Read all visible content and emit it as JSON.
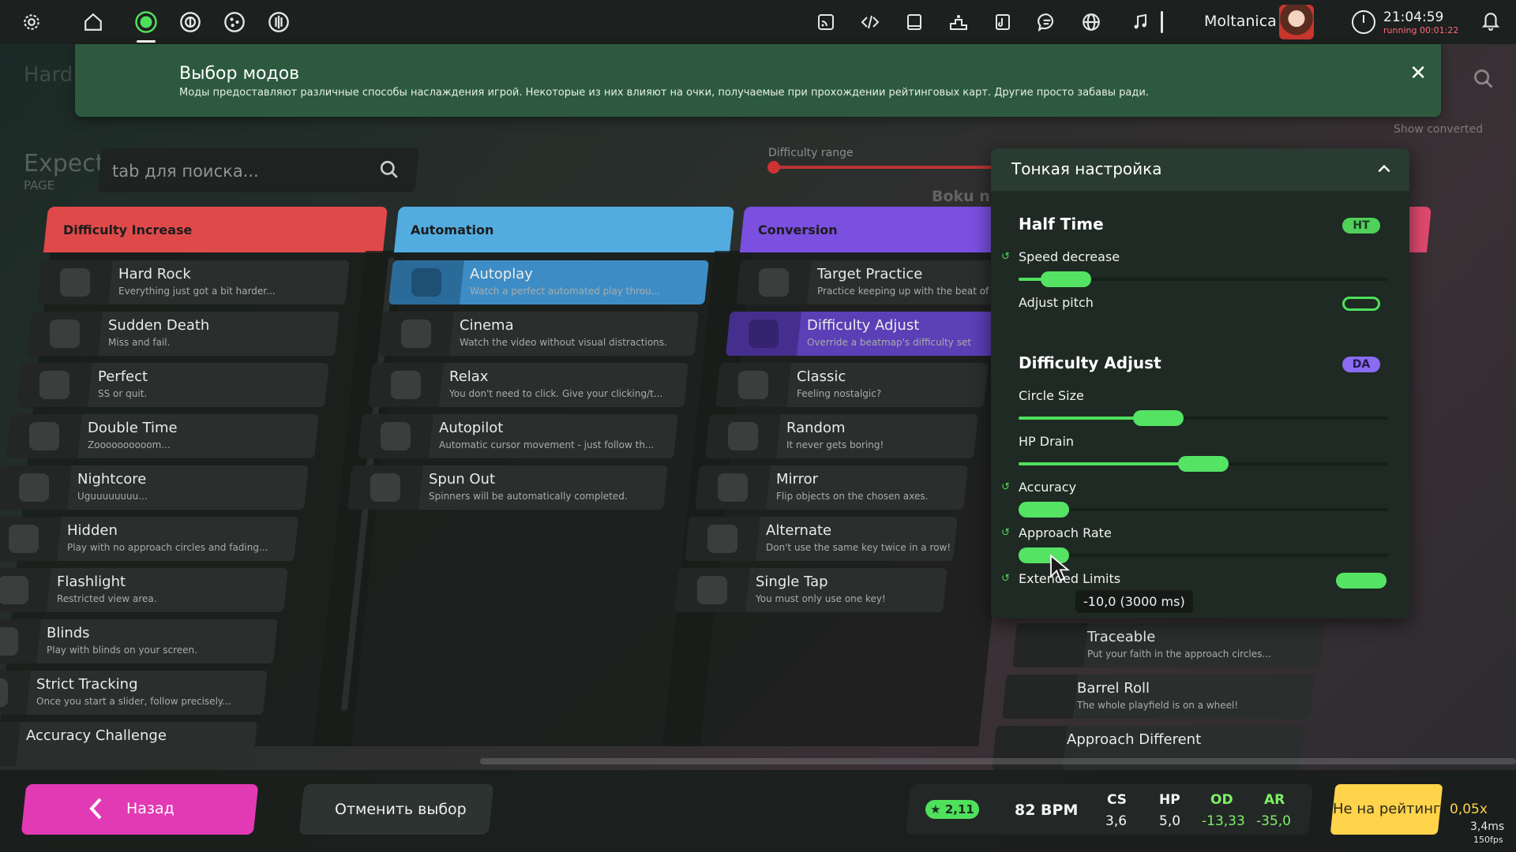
{
  "toolbar": {
    "username": "Moltanica",
    "time": "21:04:59",
    "running": "running 00:01:22"
  },
  "background": {
    "hard": "Hard",
    "expect": "Expect",
    "page": "PAGE",
    "difficulty_range": "Difficulty range",
    "show_converted": "Show converted",
    "boku": "Boku n"
  },
  "banner": {
    "title": "Выбор модов",
    "description": "Моды предоставляют различные способы наслаждения игрой. Некоторые из них влияют на очки, получаемые при прохождении рейтинговых карт. Другие просто забавы ради."
  },
  "search": {
    "placeholder": "tab для поиска..."
  },
  "columns": [
    {
      "title": "Difficulty Increase",
      "color": "#e0494a",
      "mods": [
        {
          "name": "Hard Rock",
          "desc": "Everything just got a bit harder..."
        },
        {
          "name": "Sudden Death",
          "desc": "Miss and fail."
        },
        {
          "name": "Perfect",
          "desc": "SS or quit."
        },
        {
          "name": "Double Time",
          "desc": "Zoooooooooom..."
        },
        {
          "name": "Nightcore",
          "desc": "Uguuuuuuuu..."
        },
        {
          "name": "Hidden",
          "desc": "Play with no approach circles and fading..."
        },
        {
          "name": "Flashlight",
          "desc": "Restricted view area."
        },
        {
          "name": "Blinds",
          "desc": "Play with blinds on your screen."
        },
        {
          "name": "Strict Tracking",
          "desc": "Once you start a slider, follow precisely..."
        },
        {
          "name": "Accuracy Challenge",
          "desc": ""
        }
      ]
    },
    {
      "title": "Automation",
      "color": "#52acdf",
      "mods": [
        {
          "name": "Autoplay",
          "desc": "Watch a perfect automated play throu...",
          "selected": true
        },
        {
          "name": "Cinema",
          "desc": "Watch the video without visual distractions."
        },
        {
          "name": "Relax",
          "desc": "You don't need to click. Give your clicking/t..."
        },
        {
          "name": "Autopilot",
          "desc": "Automatic cursor movement - just follow th..."
        },
        {
          "name": "Spun Out",
          "desc": "Spinners will be automatically completed."
        }
      ]
    },
    {
      "title": "Conversion",
      "color": "#7b4fe0",
      "mods": [
        {
          "name": "Target Practice",
          "desc": "Practice keeping up with the beat of"
        },
        {
          "name": "Difficulty Adjust",
          "desc": "Override a beatmap's difficulty set",
          "selected": true
        },
        {
          "name": "Classic",
          "desc": "Feeling nostalgic?"
        },
        {
          "name": "Random",
          "desc": "It never gets boring!"
        },
        {
          "name": "Mirror",
          "desc": "Flip objects on the chosen axes."
        },
        {
          "name": "Alternate",
          "desc": "Don't use the same key twice in a row!"
        },
        {
          "name": "Single Tap",
          "desc": "You must only use one key!"
        }
      ]
    }
  ],
  "fun_mods": [
    {
      "name": "Traceable",
      "desc": "Put your faith in the approach circles..."
    },
    {
      "name": "Barrel Roll",
      "desc": "The whole playfield is on a wheel!"
    },
    {
      "name": "Approach Different",
      "desc": ""
    }
  ],
  "panel": {
    "title": "Тонкая настройка",
    "half_time": {
      "title": "Half Time",
      "badge": "HT",
      "speed_decrease": "Speed decrease",
      "speed_value": 0.07,
      "adjust_pitch": "Adjust pitch",
      "adjust_pitch_on": false
    },
    "difficulty_adjust": {
      "title": "Difficulty Adjust",
      "badge": "DA",
      "circle_size": "Circle Size",
      "circle_size_value": 0.36,
      "hp_drain": "HP Drain",
      "hp_drain_value": 0.5,
      "accuracy": "Accuracy",
      "accuracy_value": 0.0,
      "approach_rate": "Approach Rate",
      "approach_rate_value": 0.0,
      "extended_limits": "Extended Limits",
      "extended_limits_on": true
    },
    "tooltip": "-10,0 (3000 ms)"
  },
  "footer": {
    "back": "Назад",
    "deselect": "Отменить выбор",
    "stars": "2,11",
    "bpm": "82 BPM",
    "cs_label": "CS",
    "cs": "3,6",
    "hp_label": "HP",
    "hp": "5,0",
    "od_label": "OD",
    "od": "-13,33",
    "ar_label": "AR",
    "ar": "-35,0",
    "unranked": "Не на рейтинг",
    "rate": "0,05x",
    "ms": "3,4ms",
    "fps": "150fps"
  }
}
